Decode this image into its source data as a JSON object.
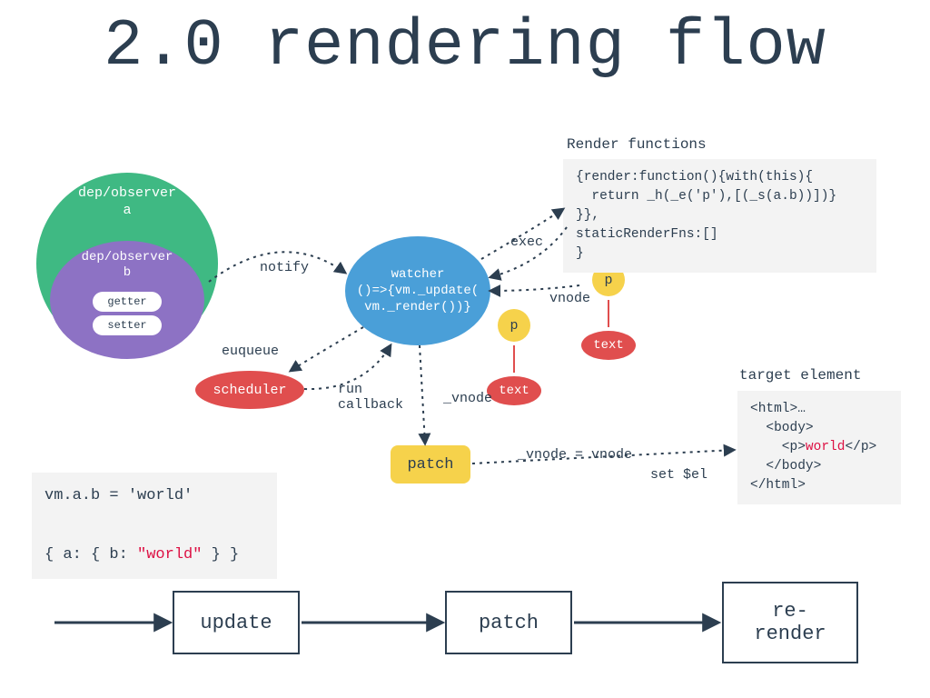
{
  "title": "2.0 rendering flow",
  "observer_a": "dep/observer\na",
  "observer_b": "dep/observer\nb",
  "getter": "getter",
  "setter": "setter",
  "watcher_text": "watcher\n()=>{vm._update(\nvm._render())}",
  "scheduler": "scheduler",
  "patch": "patch",
  "vnode_p": "p",
  "vnode_text": "text",
  "vcap_left": "_vnode",
  "vcap_right": "vnode",
  "render_label": "Render functions",
  "render_code": "{render:function(){with(this){\n  return _h(_e('p'),[(_s(a.b))])}\n}},\nstaticRenderFns:[]\n}",
  "target_label": "target element",
  "target_pre": "<html>…\n  <body>\n    <p>",
  "target_word": "world",
  "target_post": "</p>\n  </body>\n</html>",
  "state_line1": "vm.a.b = 'world'",
  "state_line2_pre": "{ a: { b: ",
  "state_line2_val": "\"world\"",
  "state_line2_post": " } }",
  "labels": {
    "notify": "notify",
    "exec": "exec",
    "euqueue": "euqueue",
    "run_callback": "run\ncallback",
    "vnode_eq": "_vnode = vnode",
    "set_el": "set $el"
  },
  "flow": {
    "update": "update",
    "patch": "patch",
    "rerender": "re-\nrender"
  }
}
